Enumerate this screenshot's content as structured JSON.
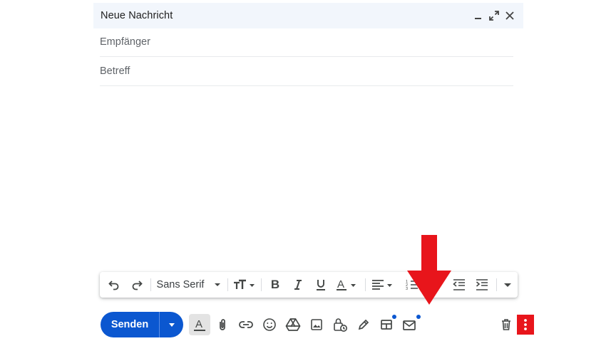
{
  "compose": {
    "title": "Neue Nachricht",
    "to_placeholder": "Empfänger",
    "subject_placeholder": "Betreff"
  },
  "format_toolbar": {
    "font_family": "Sans Serif",
    "text_color_letter": "A"
  },
  "bottom_toolbar": {
    "send_label": "Senden",
    "formatting_letter": "A"
  },
  "colors": {
    "send_blue": "#0b57d0",
    "header_bg": "#f2f6fc",
    "highlight_red": "#e8151b"
  },
  "icons": [
    "minimize-icon",
    "popout-icon",
    "close-icon",
    "undo-icon",
    "redo-icon",
    "text-size-icon",
    "bold-icon",
    "italic-icon",
    "underline-icon",
    "text-color-icon",
    "align-icon",
    "numbered-list-icon",
    "indent-less-icon",
    "indent-more-icon",
    "attach-icon",
    "link-icon",
    "emoji-icon",
    "drive-icon",
    "photo-icon",
    "confidential-icon",
    "signature-icon",
    "layouts-icon",
    "mail-merge-icon",
    "more-options-icon",
    "trash-icon"
  ]
}
